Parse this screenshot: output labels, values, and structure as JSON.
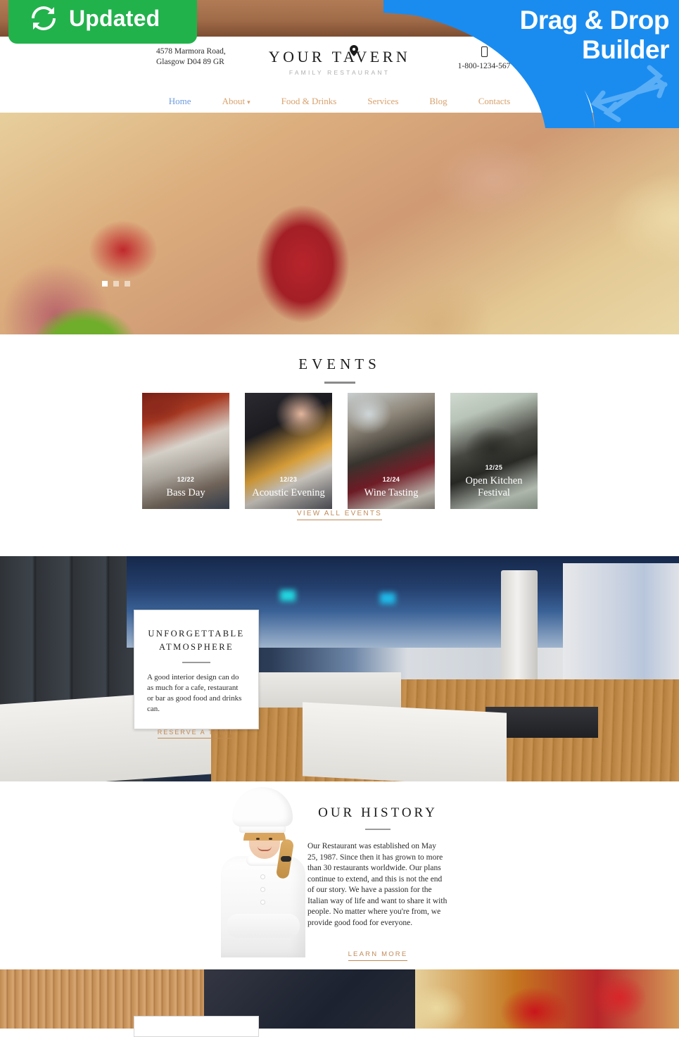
{
  "badges": {
    "updated_label": "Updated",
    "updated_icon": "refresh-icon",
    "updated_color": "#22b24c",
    "builder_line1": "Drag & Drop",
    "builder_line2": "Builder",
    "builder_icon": "four-way-arrow-icon",
    "builder_color": "#1a8cf0"
  },
  "header": {
    "address_line1": "4578 Marmora Road,",
    "address_line2": "Glasgow D04 89 GR",
    "address_icon": "map-pin-icon",
    "logo_main": "YOUR TAVERN",
    "logo_sub": "FAMILY RESTAURANT",
    "phone": "1-800-1234-567",
    "phone_icon": "mobile-phone-icon"
  },
  "nav": {
    "items": [
      {
        "label": "Home",
        "active": true,
        "has_dropdown": false
      },
      {
        "label": "About",
        "active": false,
        "has_dropdown": true
      },
      {
        "label": "Food & Drinks",
        "active": false,
        "has_dropdown": false
      },
      {
        "label": "Services",
        "active": false,
        "has_dropdown": false
      },
      {
        "label": "Blog",
        "active": false,
        "has_dropdown": false
      },
      {
        "label": "Contacts",
        "active": false,
        "has_dropdown": false
      }
    ],
    "active_color": "#6d9be0",
    "link_color": "#d8a16d",
    "chevron_icon": "chevron-down-icon"
  },
  "hero": {
    "slides": 3,
    "active_slide": 1,
    "image_description": "seafood risotto with octopus and basil"
  },
  "events": {
    "title": "EVENTS",
    "cards": [
      {
        "date": "12/22",
        "name": "Bass Day"
      },
      {
        "date": "12/23",
        "name": "Acoustic Evening"
      },
      {
        "date": "12/24",
        "name": "Wine Tasting"
      },
      {
        "date": "12/25",
        "name": "Open Kitchen Festival"
      }
    ],
    "view_all_label": "VIEW ALL EVENTS"
  },
  "atmosphere": {
    "title_line1": "UNFORGETTABLE",
    "title_line2": "ATMOSPHERE",
    "body": "A good interior design can do as much for a cafe, restaurant or bar as good food and drinks can.",
    "button_label": "RESERVE A TABLE"
  },
  "history": {
    "title": "OUR HISTORY",
    "body": "Our Restaurant was established on May 25, 1987. Since then it has grown to more than 30 restaurants worldwide. Our plans continue to extend, and this is not the end of our story. We have a passion for the Italian way of life and want to share it with people. No matter where you're from, we provide good food for everyone.",
    "button_label": "LEARN MORE",
    "chef_image": "female-chef-in-white-uniform"
  },
  "footer_band": {
    "image_description": "noodles with red peppers on bamboo mat"
  },
  "theme": {
    "accent": "#c08a57",
    "link_blue": "#6d9be0",
    "text_dark": "#1b1b1b"
  }
}
